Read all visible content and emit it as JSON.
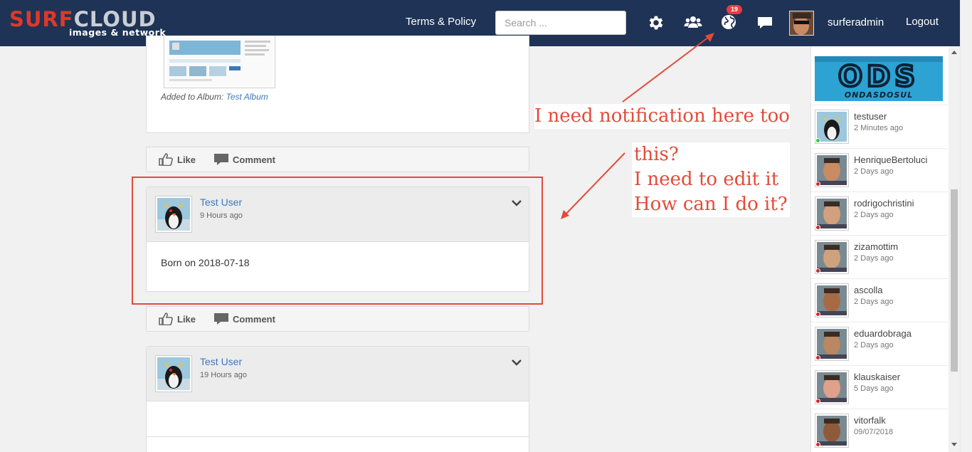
{
  "topbar": {
    "logo_surf": "SURF",
    "logo_cloud": "CLOUD",
    "logo_sub": "images & network",
    "terms_label": "Terms & Policy",
    "search_placeholder": "Search ...",
    "notification_count": "19",
    "username": "surferadmin",
    "logout_label": "Logout",
    "icons": [
      "gear-icon",
      "users-icon",
      "globe-icon",
      "chat-icon"
    ]
  },
  "feed": {
    "partial_post": {
      "album_prefix": "Added to Album:",
      "album_name": "Test Album"
    },
    "posts": [
      {
        "author": "Test User",
        "time": "9 Hours ago",
        "body": "Born on 2018-07-18"
      },
      {
        "author": "Test User",
        "time": "19 Hours ago",
        "body": ""
      }
    ],
    "like_label": "Like",
    "comment_label": "Comment"
  },
  "sidebar": {
    "banner_text": "ODS",
    "banner_sub": "ONDASDOSUL",
    "users": [
      {
        "name": "testuser",
        "time": "2 Minutes ago",
        "status": "online"
      },
      {
        "name": "HenriqueBertoluci",
        "time": "2 Days ago",
        "status": "offline"
      },
      {
        "name": "rodrigochristini",
        "time": "2 Days ago",
        "status": "offline"
      },
      {
        "name": "zizamottim",
        "time": "2 Days ago",
        "status": "offline"
      },
      {
        "name": "ascolla",
        "time": "2 Days ago",
        "status": "offline"
      },
      {
        "name": "eduardobraga",
        "time": "2 Days ago",
        "status": "offline"
      },
      {
        "name": "klauskaiser",
        "time": "5 Days ago",
        "status": "offline"
      },
      {
        "name": "vitorfalk",
        "time": "09/07/2018",
        "status": "offline"
      }
    ]
  },
  "annotations": {
    "notification_note": "I need notification here too",
    "edit_note_1": "this?",
    "edit_note_2": "I need to edit it",
    "edit_note_3": "How can I do it?"
  },
  "colors": {
    "topbar": "#1e3355",
    "accent_red": "#e24b3a",
    "link_blue": "#3b79b8",
    "online": "#2ecc40",
    "offline": "#d9262b"
  }
}
